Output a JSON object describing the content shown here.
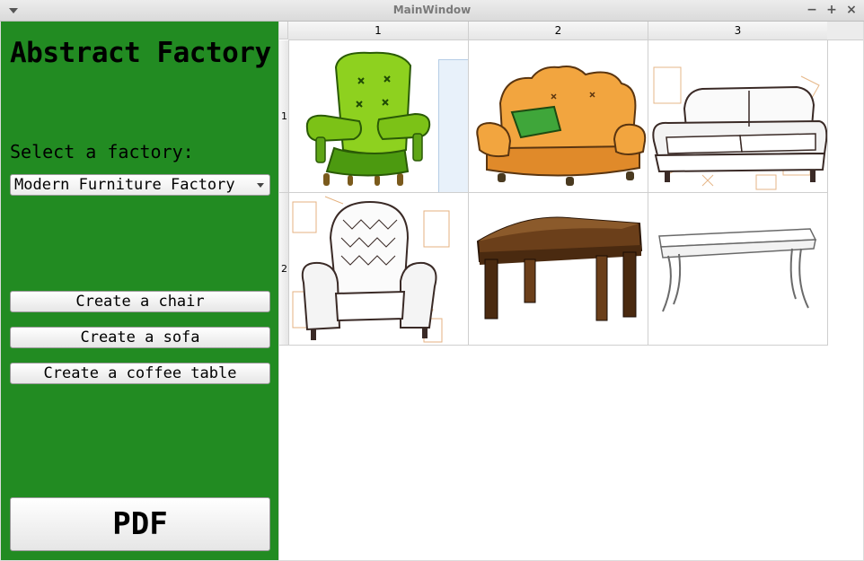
{
  "window": {
    "title": "MainWindow"
  },
  "sidebar": {
    "app_title": "Abstract Factory",
    "select_label": "Select a factory:",
    "factory_selected": "Modern Furniture Factory",
    "buttons": {
      "create_chair": "Create a chair",
      "create_sofa": "Create a sofa",
      "create_coffee_table": "Create a coffee table",
      "pdf": "PDF"
    },
    "background_color": "#228b22"
  },
  "table": {
    "column_headers": [
      "1",
      "2",
      "3"
    ],
    "row_headers": [
      "1",
      "2"
    ],
    "cells": [
      [
        "green-armchair-image",
        "orange-sofa-image",
        "sketch-sofa-image"
      ],
      [
        "sketch-armchair-image",
        "wooden-coffee-table-image",
        "sketch-coffee-table-image"
      ]
    ]
  }
}
